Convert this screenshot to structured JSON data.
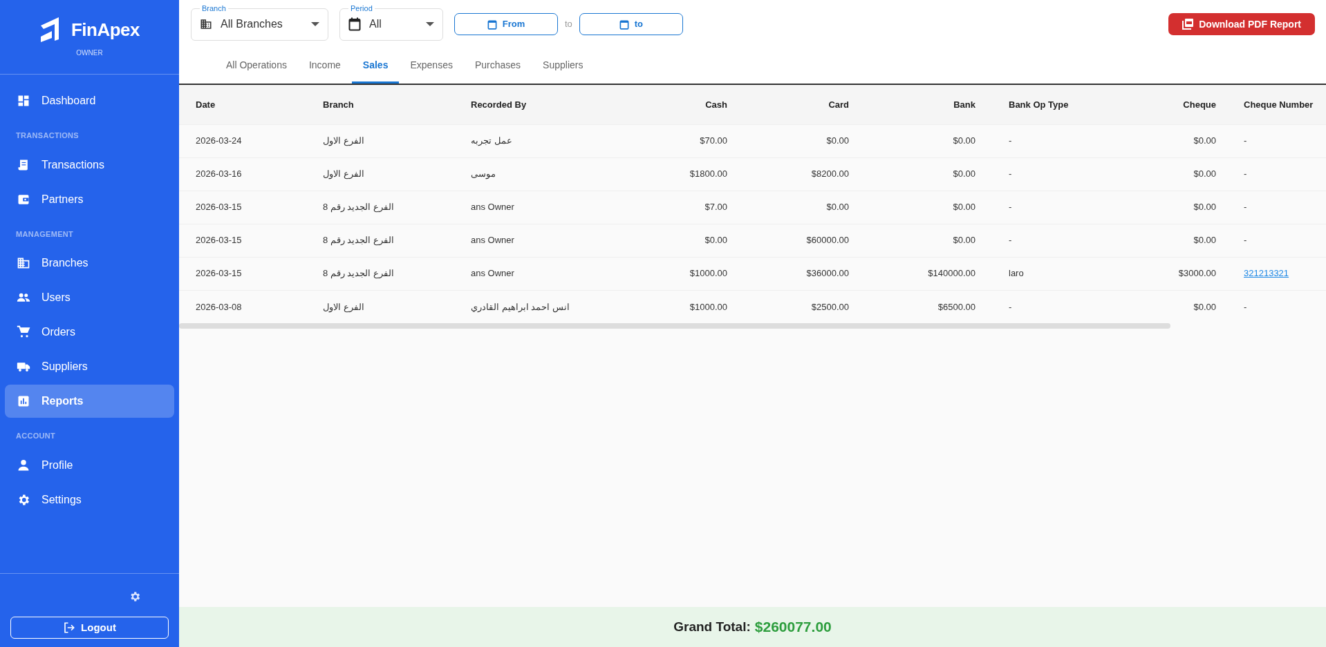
{
  "sidebar": {
    "brand": "FinApex",
    "role": "OWNER",
    "sections": [
      {
        "items": [
          {
            "label": "Dashboard",
            "selected": false
          }
        ]
      },
      {
        "title": "TRANSACTIONS",
        "items": [
          {
            "label": "Transactions",
            "selected": false
          },
          {
            "label": "Partners",
            "selected": false
          }
        ]
      },
      {
        "title": "MANAGEMENT",
        "items": [
          {
            "label": "Branches",
            "selected": false
          },
          {
            "label": "Users",
            "selected": false
          },
          {
            "label": "Orders",
            "selected": false
          },
          {
            "label": "Suppliers",
            "selected": false
          },
          {
            "label": "Reports",
            "selected": true
          }
        ]
      },
      {
        "title": "ACCOUNT",
        "items": [
          {
            "label": "Profile",
            "selected": false
          },
          {
            "label": "Settings",
            "selected": false
          }
        ]
      }
    ],
    "logout": "Logout"
  },
  "filters": {
    "branch": {
      "label": "Branch",
      "value": "All Branches"
    },
    "period": {
      "label": "Period",
      "value": "All"
    },
    "from": "From",
    "separator": "to",
    "to": "to"
  },
  "download_button": "Download PDF Report",
  "tabs": [
    {
      "label": "All Operations",
      "selected": false
    },
    {
      "label": "Income",
      "selected": false
    },
    {
      "label": "Sales",
      "selected": true
    },
    {
      "label": "Expenses",
      "selected": false
    },
    {
      "label": "Purchases",
      "selected": false
    },
    {
      "label": "Suppliers",
      "selected": false
    }
  ],
  "table": {
    "columns": [
      "Date",
      "Branch",
      "Recorded By",
      "Cash",
      "Card",
      "Bank",
      "Bank Op Type",
      "Cheque",
      "Cheque Number"
    ],
    "rows": [
      {
        "cells": [
          "2026-03-24",
          "الفرع الاول",
          "عمل تجربه",
          "$70.00",
          "$0.00",
          "$0.00",
          "-",
          "$0.00",
          "-"
        ],
        "cheque_link": false
      },
      {
        "cells": [
          "2026-03-16",
          "الفرع الاول",
          "موسى",
          "$1800.00",
          "$8200.00",
          "$0.00",
          "-",
          "$0.00",
          "-"
        ],
        "cheque_link": false
      },
      {
        "cells": [
          "2026-03-15",
          "الفرع الجديد رقم 8",
          "ans Owner",
          "$7.00",
          "$0.00",
          "$0.00",
          "-",
          "$0.00",
          "-"
        ],
        "cheque_link": false
      },
      {
        "cells": [
          "2026-03-15",
          "الفرع الجديد رقم 8",
          "ans Owner",
          "$0.00",
          "$60000.00",
          "$0.00",
          "-",
          "$0.00",
          "-"
        ],
        "cheque_link": false
      },
      {
        "cells": [
          "2026-03-15",
          "الفرع الجديد رقم 8",
          "ans Owner",
          "$1000.00",
          "$36000.00",
          "$140000.00",
          "laro",
          "$3000.00",
          "321213321"
        ],
        "cheque_link": true
      },
      {
        "cells": [
          "2026-03-08",
          "الفرع الاول",
          "انس احمد ابراهيم القادري",
          "$1000.00",
          "$2500.00",
          "$6500.00",
          "-",
          "$0.00",
          "-"
        ],
        "cheque_link": false
      }
    ]
  },
  "grand_total": {
    "label": "Grand Total:",
    "value": "$260077.00"
  }
}
